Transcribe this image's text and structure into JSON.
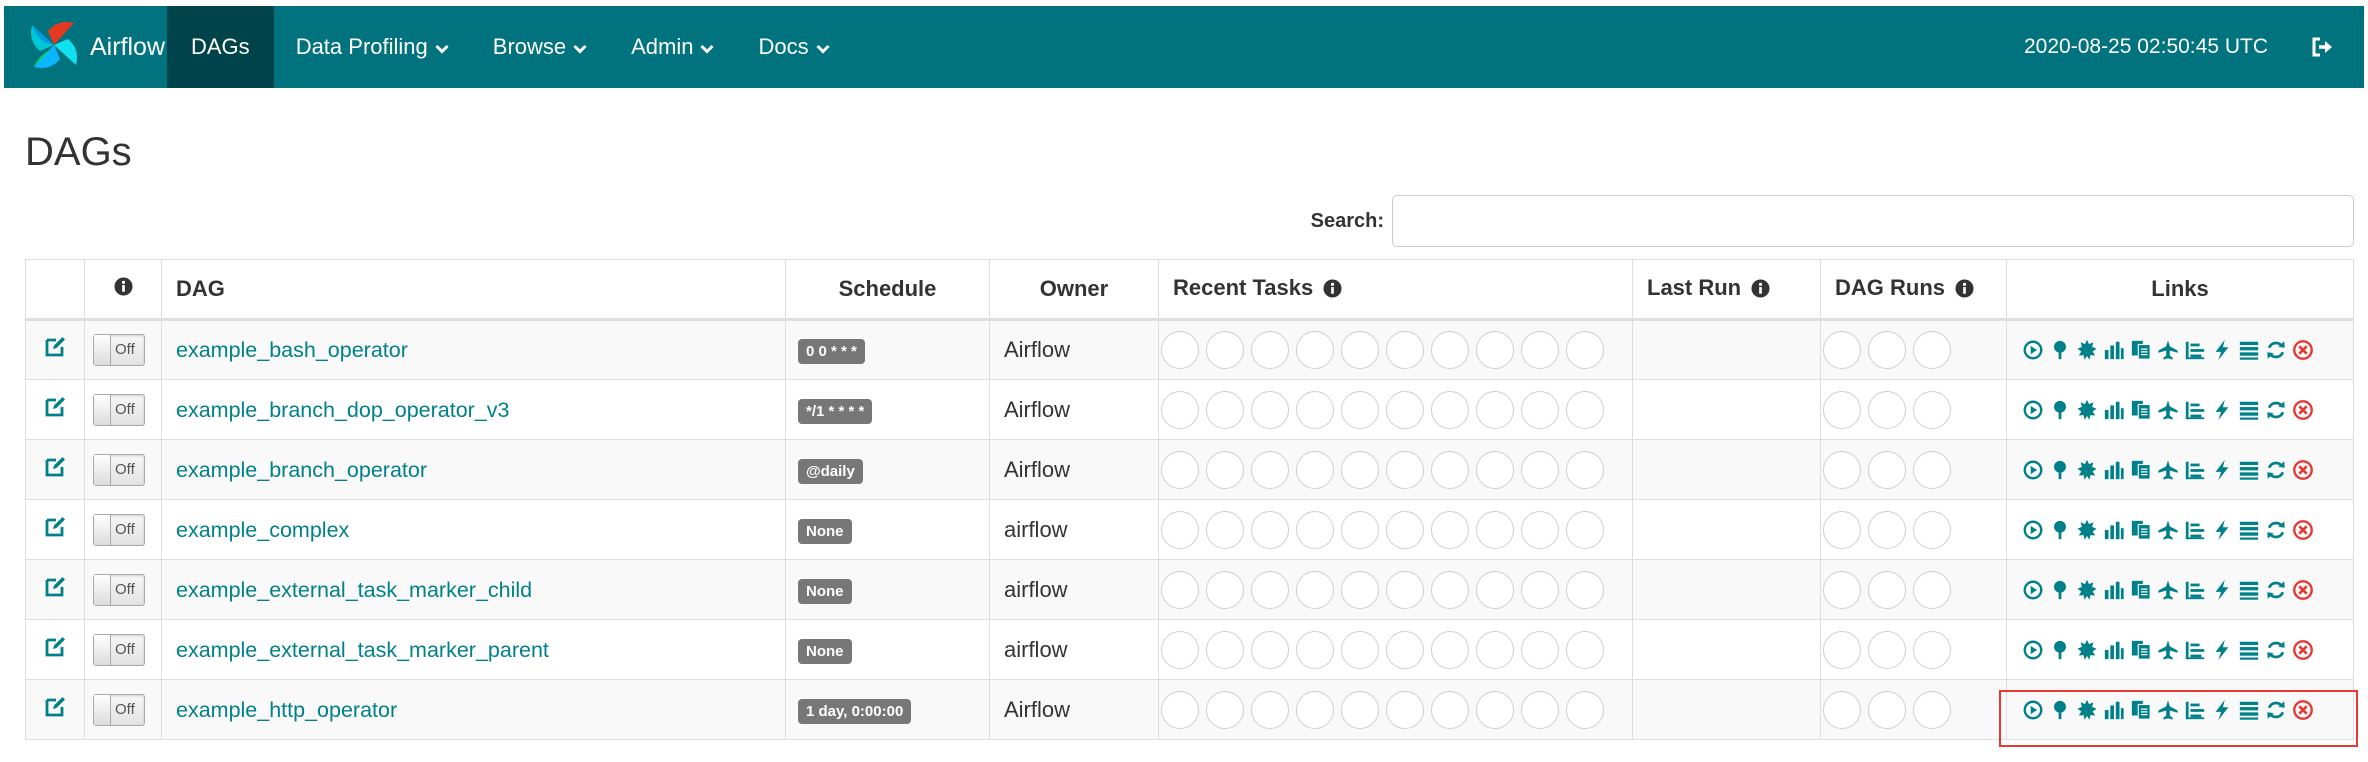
{
  "brand": {
    "name": "Airflow"
  },
  "nav": {
    "items": [
      {
        "label": "DAGs",
        "active": true,
        "dropdown": false
      },
      {
        "label": "Data Profiling",
        "active": false,
        "dropdown": true
      },
      {
        "label": "Browse",
        "active": false,
        "dropdown": true
      },
      {
        "label": "Admin",
        "active": false,
        "dropdown": true
      },
      {
        "label": "Docs",
        "active": false,
        "dropdown": true
      }
    ],
    "time": "2020-08-25 02:50:45 UTC"
  },
  "page": {
    "title": "DAGs"
  },
  "search": {
    "label": "Search:",
    "value": "",
    "placeholder": ""
  },
  "table": {
    "headers": {
      "dag": "DAG",
      "schedule": "Schedule",
      "owner": "Owner",
      "recent_tasks": "Recent Tasks",
      "last_run": "Last Run",
      "dag_runs": "DAG Runs",
      "links": "Links"
    },
    "rows": [
      {
        "dag": "example_bash_operator",
        "toggle": "Off",
        "schedule": "0 0 * * *",
        "owner": "Airflow",
        "last_run": ""
      },
      {
        "dag": "example_branch_dop_operator_v3",
        "toggle": "Off",
        "schedule": "*/1 * * * *",
        "owner": "Airflow",
        "last_run": ""
      },
      {
        "dag": "example_branch_operator",
        "toggle": "Off",
        "schedule": "@daily",
        "owner": "Airflow",
        "last_run": ""
      },
      {
        "dag": "example_complex",
        "toggle": "Off",
        "schedule": "None",
        "owner": "airflow",
        "last_run": ""
      },
      {
        "dag": "example_external_task_marker_child",
        "toggle": "Off",
        "schedule": "None",
        "owner": "airflow",
        "last_run": ""
      },
      {
        "dag": "example_external_task_marker_parent",
        "toggle": "Off",
        "schedule": "None",
        "owner": "airflow",
        "last_run": ""
      },
      {
        "dag": "example_http_operator",
        "toggle": "Off",
        "schedule": "1 day, 0:00:00",
        "owner": "Airflow",
        "last_run": ""
      }
    ],
    "recent_task_circles": 10,
    "dag_run_circles": 3,
    "link_icons": [
      "trigger-dag-icon",
      "tree-view-icon",
      "graph-view-icon",
      "tries-chart-icon",
      "code-view-icon",
      "gantt-icon",
      "landing-times-icon",
      "task-duration-icon",
      "logs-icon",
      "refresh-icon",
      "delete-icon"
    ]
  },
  "colors": {
    "navbar": "#00737e",
    "navbar_active": "#00434a",
    "link": "#00818a",
    "label_bg": "#777777",
    "delete": "#e53935",
    "highlight": "#e53935"
  }
}
